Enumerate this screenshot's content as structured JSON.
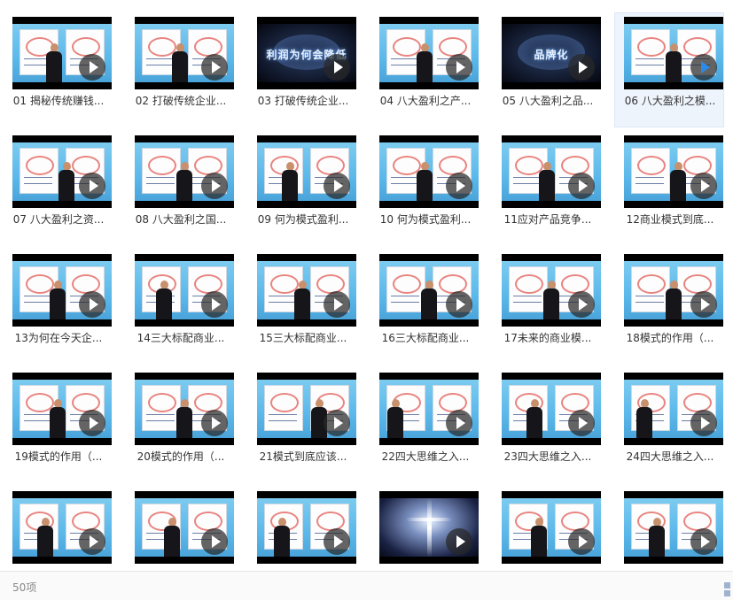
{
  "videos": [
    {
      "title": "01 揭秘传统赚钱...",
      "scene": "studio",
      "person": 0.4,
      "selected": false,
      "caption": ""
    },
    {
      "title": "02 打破传统企业...",
      "scene": "studio",
      "person": 0.45,
      "selected": false,
      "caption": ""
    },
    {
      "title": "03 打破传统企业...",
      "scene": "dark",
      "person": null,
      "selected": false,
      "caption": "利润为何会降低"
    },
    {
      "title": "04 八大盈利之产...",
      "scene": "studio",
      "person": 0.45,
      "selected": false,
      "caption": ""
    },
    {
      "title": "05 八大盈利之品...",
      "scene": "dark",
      "person": null,
      "selected": false,
      "caption": "品牌化"
    },
    {
      "title": "06 八大盈利之模...",
      "scene": "studio",
      "person": 0.5,
      "selected": true,
      "caption": ""
    },
    {
      "title": "07 八大盈利之资...",
      "scene": "studio",
      "person": 0.55,
      "selected": false,
      "caption": ""
    },
    {
      "title": "08 八大盈利之国...",
      "scene": "studio",
      "person": 0.5,
      "selected": false,
      "caption": ""
    },
    {
      "title": "09 何为模式盈利...",
      "scene": "studio",
      "person": 0.3,
      "selected": false,
      "caption": ""
    },
    {
      "title": "10 何为模式盈利...",
      "scene": "studio",
      "person": 0.45,
      "selected": false,
      "caption": ""
    },
    {
      "title": "11应对产品竞争...",
      "scene": "studio",
      "person": 0.45,
      "selected": false,
      "caption": ""
    },
    {
      "title": "12商业模式到底...",
      "scene": "studio",
      "person": 0.55,
      "selected": false,
      "caption": ""
    },
    {
      "title": "13为何在今天企...",
      "scene": "studio",
      "person": 0.45,
      "selected": false,
      "caption": ""
    },
    {
      "title": "14三大标配商业...",
      "scene": "studio",
      "person": 0.25,
      "selected": false,
      "caption": ""
    },
    {
      "title": "15三大标配商业...",
      "scene": "studio",
      "person": 0.45,
      "selected": false,
      "caption": ""
    },
    {
      "title": "16三大标配商业...",
      "scene": "studio",
      "person": 0.5,
      "selected": false,
      "caption": ""
    },
    {
      "title": "17未来的商业模...",
      "scene": "studio",
      "person": 0.5,
      "selected": false,
      "caption": ""
    },
    {
      "title": "18模式的作用（...",
      "scene": "studio",
      "person": 0.5,
      "selected": false,
      "caption": ""
    },
    {
      "title": "19模式的作用（...",
      "scene": "studio",
      "person": 0.45,
      "selected": false,
      "caption": ""
    },
    {
      "title": "20模式的作用（...",
      "scene": "studio",
      "person": 0.5,
      "selected": false,
      "caption": ""
    },
    {
      "title": "21模式到底应该...",
      "scene": "studio",
      "person": 0.65,
      "selected": false,
      "caption": ""
    },
    {
      "title": "22四大思维之入...",
      "scene": "studio",
      "person": 0.1,
      "selected": false,
      "caption": ""
    },
    {
      "title": "23四大思维之入...",
      "scene": "studio",
      "person": 0.3,
      "selected": false,
      "caption": ""
    },
    {
      "title": "24四大思维之入...",
      "scene": "studio",
      "person": 0.15,
      "selected": false,
      "caption": ""
    },
    {
      "title": "",
      "scene": "studio",
      "person": 0.3,
      "selected": false,
      "caption": ""
    },
    {
      "title": "",
      "scene": "studio",
      "person": 0.35,
      "selected": false,
      "caption": ""
    },
    {
      "title": "",
      "scene": "studio",
      "person": 0.2,
      "selected": false,
      "caption": ""
    },
    {
      "title": "",
      "scene": "light",
      "person": null,
      "selected": false,
      "caption": ""
    },
    {
      "title": "",
      "scene": "studio",
      "person": 0.35,
      "selected": false,
      "caption": ""
    },
    {
      "title": "",
      "scene": "studio",
      "person": 0.3,
      "selected": false,
      "caption": ""
    }
  ],
  "status": {
    "count": "50项"
  },
  "icons": {
    "play": "play-button-icon",
    "view_toggle": "grid-view-icon"
  },
  "colors": {
    "selected_bg": "#eef4fc",
    "studio_blue": "#5bb8ea",
    "text": "#333333"
  }
}
